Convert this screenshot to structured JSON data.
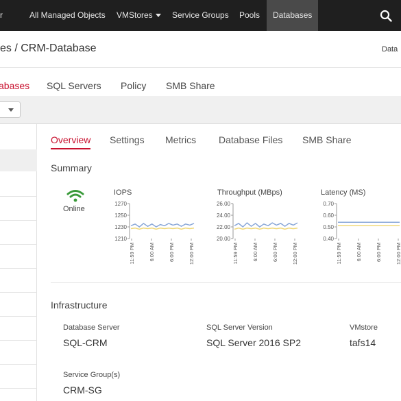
{
  "topnav": {
    "partial_item": "r",
    "items": [
      {
        "label": "All Managed Objects"
      },
      {
        "label": "VMStores"
      },
      {
        "label": "Service Groups"
      },
      {
        "label": "Pools"
      },
      {
        "label": "Databases"
      }
    ],
    "active": "Databases",
    "search_icon": "search-icon"
  },
  "breadcrumb": {
    "text": "es / CRM-Database",
    "right_text": "Data"
  },
  "primary_tabs": {
    "items": [
      "abases",
      "SQL Servers",
      "Policy",
      "SMB Share"
    ],
    "active": "abases",
    "accent": "#c8102e"
  },
  "secondary_tabs": {
    "items": [
      "Overview",
      "Settings",
      "Metrics",
      "Database Files",
      "SMB Share"
    ],
    "active": "Overview"
  },
  "summary": {
    "title": "Summary",
    "status_icon": "wifi-icon",
    "status_label": "Online",
    "status_color": "#3a9a3a"
  },
  "chart_data": [
    {
      "type": "line",
      "title": "IOPS",
      "y_ticks": [
        "1270",
        "1250",
        "1230",
        "1210"
      ],
      "ylim": [
        1210,
        1270
      ],
      "x_ticks": [
        "11:59 PM",
        "6:00 AM",
        "6:00 PM",
        "12:00 PM"
      ],
      "series": [
        {
          "color": "#8aa8d8",
          "values": [
            1232,
            1235,
            1230,
            1236,
            1231,
            1235,
            1230,
            1234,
            1232,
            1236,
            1233,
            1235,
            1231,
            1235,
            1233,
            1236
          ]
        },
        {
          "color": "#f0d878",
          "values": [
            1227,
            1228,
            1226,
            1228,
            1227,
            1228,
            1226,
            1228,
            1227,
            1228,
            1227,
            1228,
            1226,
            1228,
            1227,
            1228
          ]
        }
      ]
    },
    {
      "type": "line",
      "title": "Throughput (MBps)",
      "y_ticks": [
        "26.00",
        "24.00",
        "22.00",
        "20.00"
      ],
      "ylim": [
        20,
        26
      ],
      "x_ticks": [
        "11:59 PM",
        "6:00 AM",
        "6:00 PM",
        "12:00 PM"
      ],
      "series": [
        {
          "color": "#8aa8d8",
          "values": [
            22.2,
            22.6,
            22.0,
            22.7,
            22.1,
            22.6,
            22.0,
            22.5,
            22.2,
            22.7,
            22.3,
            22.6,
            22.1,
            22.6,
            22.3,
            22.7
          ]
        },
        {
          "color": "#f0d878",
          "values": [
            21.6,
            21.8,
            21.6,
            21.8,
            21.7,
            21.8,
            21.6,
            21.8,
            21.7,
            21.8,
            21.7,
            21.8,
            21.6,
            21.8,
            21.7,
            21.8
          ]
        }
      ]
    },
    {
      "type": "line",
      "title": "Latency (MS)",
      "y_ticks": [
        "0.70",
        "0.60",
        "0.50",
        "0.40"
      ],
      "ylim": [
        0.4,
        0.7
      ],
      "x_ticks": [
        "11:59 PM",
        "6:00 AM",
        "6:00 PM",
        "12:00 PM"
      ],
      "series": [
        {
          "color": "#8aa8d8",
          "values": [
            0.54,
            0.54,
            0.54,
            0.54,
            0.54,
            0.54,
            0.54,
            0.54,
            0.54,
            0.54,
            0.54,
            0.54,
            0.54,
            0.54,
            0.54,
            0.54
          ]
        },
        {
          "color": "#f0d878",
          "values": [
            0.51,
            0.51,
            0.51,
            0.51,
            0.51,
            0.51,
            0.51,
            0.51,
            0.51,
            0.51,
            0.51,
            0.51,
            0.51,
            0.51,
            0.51,
            0.51
          ]
        }
      ]
    }
  ],
  "infrastructure": {
    "title": "Infrastructure",
    "database_server": {
      "label": "Database Server",
      "value": "SQL-CRM"
    },
    "sql_version": {
      "label": "SQL Server Version",
      "value": "SQL Server 2016 SP2"
    },
    "vmstore": {
      "label": "VMstore",
      "value": "tafs14"
    },
    "service_group": {
      "label": "Service Group(s)",
      "value": "CRM-SG"
    }
  }
}
